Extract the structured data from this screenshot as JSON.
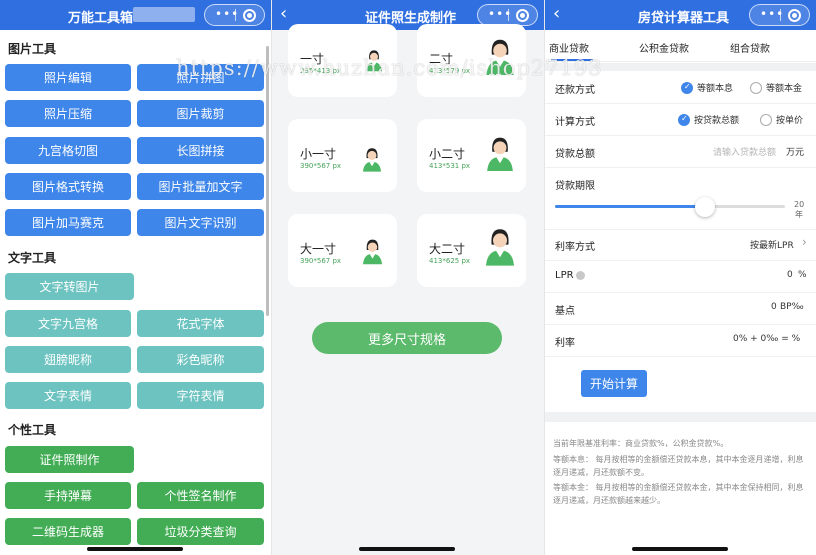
{
  "tool_app": {
    "title": "万能工具箱",
    "sections": {
      "image_tools": "图片工具",
      "text_tools": "文字工具",
      "personal_tools": "个性工具"
    },
    "image_buttons": [
      "照片编辑",
      "照片拼图",
      "照片压缩",
      "图片裁剪",
      "九宫格切图",
      "长图拼接",
      "图片格式转换",
      "图片批量加文字",
      "图片加马赛克",
      "图片文字识别"
    ],
    "text_buttons": [
      "文字转图片",
      "文字九宫格",
      "花式字体",
      "翅膀昵称",
      "彩色昵称",
      "文字表情",
      "字符表情"
    ],
    "personal_buttons": [
      "证件照制作",
      "手持弹幕",
      "个性签名制作",
      "二维码生成器",
      "垃圾分类查询"
    ]
  },
  "id_photo": {
    "title": "证件照生成制作",
    "cards": [
      {
        "name": "一寸",
        "size": "295*413 px"
      },
      {
        "name": "二寸",
        "size": "413*579 px"
      },
      {
        "name": "小一寸",
        "size": "390*567 px"
      },
      {
        "name": "小二寸",
        "size": "413*531 px"
      },
      {
        "name": "大一寸",
        "size": "390*567 px"
      },
      {
        "name": "大二寸",
        "size": "413*625 px"
      }
    ],
    "more_button": "更多尺寸规格"
  },
  "mortgage": {
    "title": "房贷计算器工具",
    "tabs": [
      "商业贷款",
      "公积金贷款",
      "组合贷款"
    ],
    "repay_label": "还款方式",
    "repay_options": [
      "等额本息",
      "等额本金"
    ],
    "calc_label": "计算方式",
    "calc_options": [
      "按贷款总额",
      "按单价"
    ],
    "total_label": "贷款总额",
    "total_placeholder": "请输入贷款总额",
    "total_unit": "万元",
    "term_label": "贷款期限",
    "term_value": "20",
    "term_unit": "年",
    "term_slider_fraction": 0.65,
    "rate_method_label": "利率方式",
    "rate_method_value": "按最新LPR",
    "lpr_label": "LPR",
    "lpr_value": "0",
    "lpr_unit": "%",
    "bp_label": "基点",
    "bp_value": "0",
    "bp_unit": "BP‰",
    "rate_label": "利率",
    "rate_value": "0% + 0‰ = %",
    "calc_button": "开始计算",
    "notes": [
      "当前年限基准利率：商业贷款%，公积金贷款%。",
      "等额本息： 每月按相等的金额偿还贷款本息，其中本金逐月递增，利息逐月递减，月还款额不变。",
      "等额本金： 每月按相等的金额偿还贷款本金，其中本金保持相同，利息逐月递减，月还款额越来越少。"
    ]
  },
  "watermark": "https://www.huzhan.com/ishop27193",
  "colors": {
    "nav_blue": "#2f6fe0",
    "btn_blue": "#3f86ea",
    "btn_teal": "#6cc3c0",
    "btn_green": "#43ad56",
    "accent_green": "#5cba6c"
  }
}
